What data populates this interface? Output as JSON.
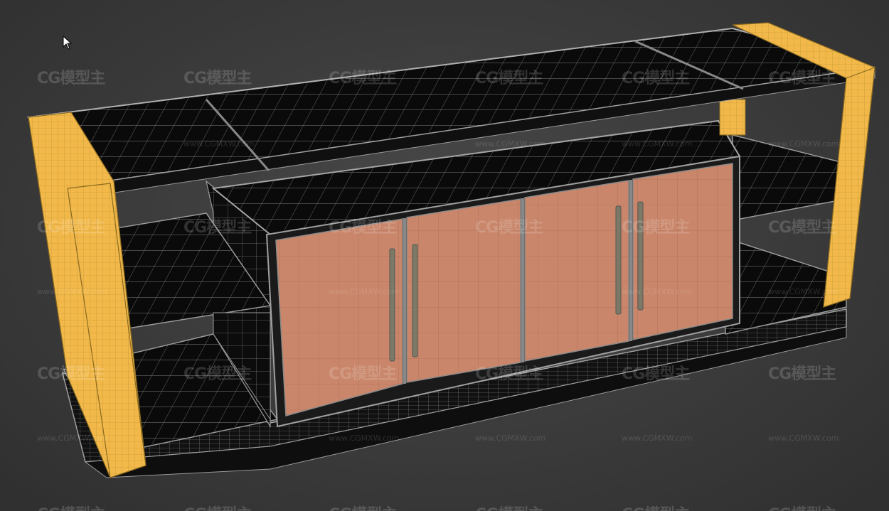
{
  "viewport": {
    "mode": "3D wireframe-on-shaded viewport",
    "background_color": "#3d3d3d"
  },
  "model": {
    "object": "TV cabinet",
    "materials": {
      "side_panels": "#f2b94a",
      "door_panels": "#c9866a",
      "surfaces": "#0a0a0a",
      "wire": "#9a9a9a",
      "handles": "#7c7a66"
    },
    "door_count": 4,
    "handle_count": 4
  },
  "watermarks": {
    "logo_text": "CG模型主",
    "url_text": "www.CGMXW.com"
  },
  "cursor": {
    "icon": "arrow-cursor-icon"
  }
}
